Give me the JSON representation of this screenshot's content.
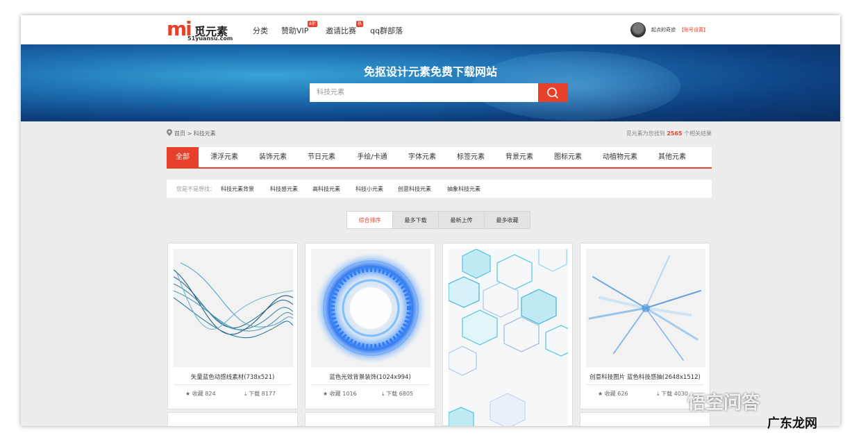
{
  "header": {
    "logo_mark": "mi",
    "logo_cn": "觅元素",
    "logo_en": "51yuansu.com",
    "nav": [
      "分类",
      "赞助VIP",
      "邀请比赛",
      "qq群部落"
    ],
    "vip_badge": "8折",
    "contest_badge": "热",
    "username": "起点的奇迹",
    "account_settings": "【账号设置】"
  },
  "banner": {
    "title": "免抠设计元素免费下载网站",
    "search_value": "科技元素",
    "search_icon": "search-icon"
  },
  "breadcrumb": {
    "home": "首页",
    "sep": ">",
    "current": "科技元素",
    "result_prefix": "觅元素为您找到",
    "result_count": "2565",
    "result_suffix": "个相关结果"
  },
  "categories": [
    "全部",
    "漂浮元素",
    "装饰元素",
    "节日元素",
    "手绘/卡通",
    "字体元素",
    "标签元素",
    "背景元素",
    "图标元素",
    "动植物元素",
    "其他元素"
  ],
  "suggestions": {
    "prefix": "您是不是想找：",
    "items": [
      "科技元素背景",
      "科技感元素",
      "高科技元素",
      "科技小元素",
      "创意科技元素",
      "抽象科技元素"
    ]
  },
  "sort": [
    "综合排序",
    "最多下载",
    "最新上传",
    "最多收藏"
  ],
  "cards": [
    {
      "title": "矢量蓝色动感线素材(738x521)",
      "fav": "收藏 824",
      "down": "下载 8177"
    },
    {
      "title": "蓝色光效背景装饰(1024x994)",
      "fav": "收藏 1016",
      "down": "下载 6805"
    },
    {
      "title": "",
      "fav": "",
      "down": ""
    },
    {
      "title": "创意科技图片 蓝色科技感抽(2648x1512)",
      "fav": "收藏 626",
      "down": "下载 4030"
    }
  ],
  "watermark": {
    "text1": "悟空问答",
    "text2": "广东龙网"
  },
  "colors": {
    "accent": "#e8412b",
    "banner": "#1d6fb3",
    "background": "#eeedee"
  }
}
